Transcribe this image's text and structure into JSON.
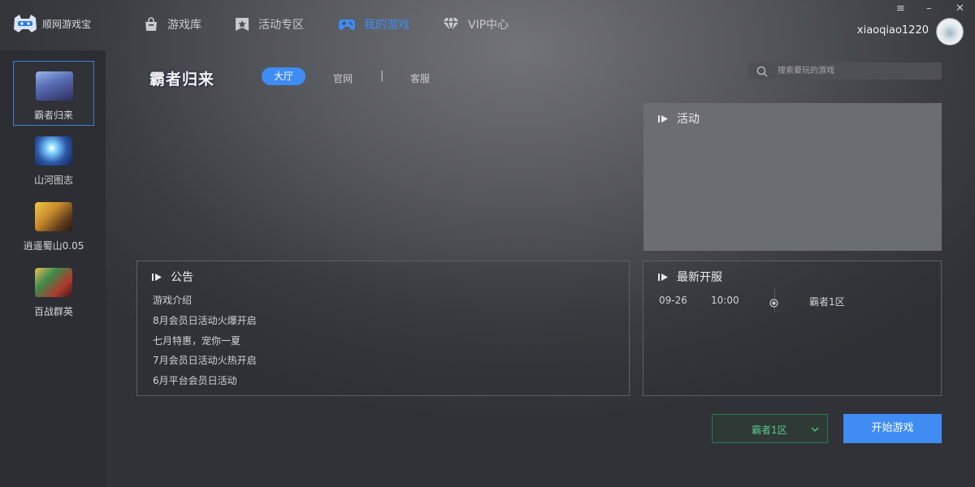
{
  "app": {
    "name": "顺网游戏宝"
  },
  "nav": [
    {
      "label": "游戏库",
      "icon": "bag-icon"
    },
    {
      "label": "活动专区",
      "icon": "star-badge-icon"
    },
    {
      "label": "我的游戏",
      "icon": "gamepad-icon",
      "active": true
    },
    {
      "label": "VIP中心",
      "icon": "diamond-icon"
    }
  ],
  "window_controls": {
    "menu": "≡",
    "minimize": "–",
    "close": "✕"
  },
  "user": {
    "name": "xiaoqiao1220"
  },
  "sidebar": {
    "games": [
      {
        "label": "霸者归来",
        "selected": true
      },
      {
        "label": "山河图志"
      },
      {
        "label": "逍遥蜀山0.05"
      },
      {
        "label": "百战群英"
      }
    ]
  },
  "game": {
    "logo_text": "霸者归来",
    "tabs": [
      "大厅",
      "官网",
      "客服"
    ],
    "active_tab": "大厅",
    "tab_separator": "|"
  },
  "search": {
    "placeholder": "搜索要玩的游戏",
    "value": ""
  },
  "activity": {
    "title": "活动"
  },
  "notice": {
    "title": "公告",
    "items": [
      "游戏介绍",
      "8月会员日活动火爆开启",
      "七月特惠，宠你一夏",
      "7月会员日活动火热开启",
      "6月平台会员日活动"
    ]
  },
  "servers": {
    "title": "最新开服",
    "list": [
      {
        "date": "09-26",
        "time": "10:00",
        "name": "霸者1区"
      }
    ]
  },
  "server_select": {
    "value": "霸者1区"
  },
  "start_button": {
    "label": "开始游戏"
  },
  "colors": {
    "accent": "#3f8cf3",
    "select_green": "#58c98b",
    "sidebar_bg": "#2c2e33"
  }
}
